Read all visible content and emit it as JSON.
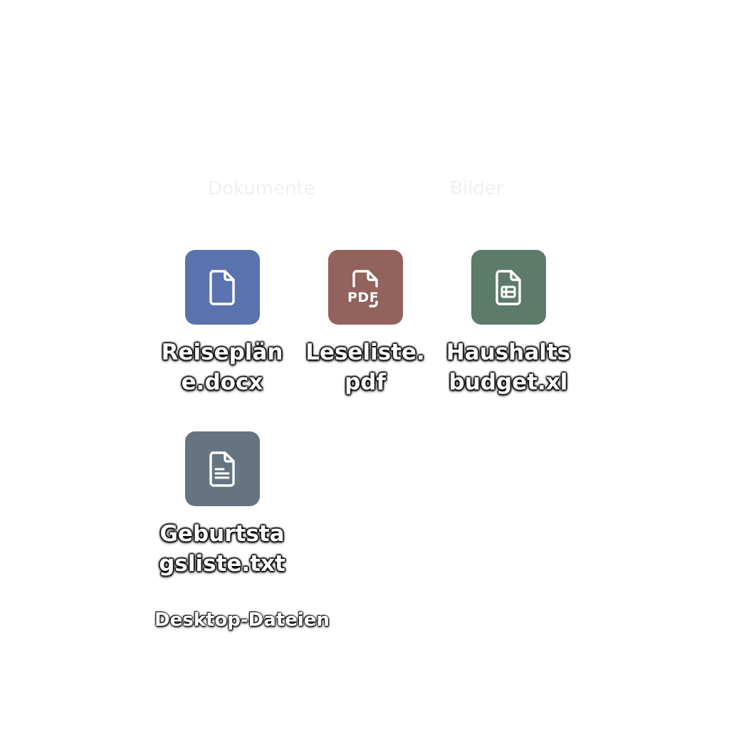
{
  "background_text": [
    "Dokumente",
    "Bilder"
  ],
  "files": [
    {
      "name": "Reisepläne.docx",
      "icon": "document-icon",
      "color": "#5a72ae"
    },
    {
      "name": "Leseliste.pdf",
      "icon": "pdf-icon",
      "color": "#93625c"
    },
    {
      "name": "Haushaltsbudget.xl",
      "icon": "spreadsheet-icon",
      "color": "#5c7b6a"
    },
    {
      "name": "Geburtstagsliste.txt",
      "icon": "text-file-icon",
      "color": "#657480"
    }
  ],
  "section_label": "Desktop-Dateien"
}
